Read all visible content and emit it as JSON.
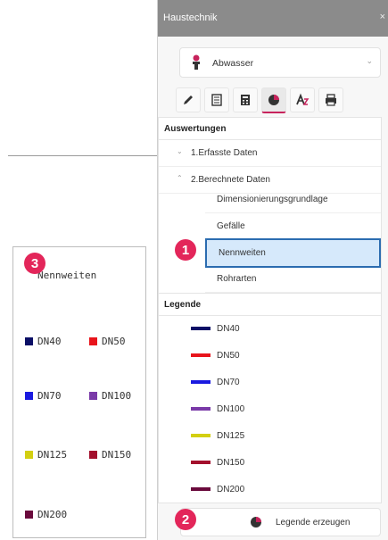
{
  "window": {
    "title": "Haustechnik",
    "close_glyph": "×"
  },
  "system_select": {
    "value": "Abwasser",
    "icon": "wastewater-icon"
  },
  "toolbar_tabs": [
    {
      "name": "pencil-icon"
    },
    {
      "name": "document-list-icon"
    },
    {
      "name": "calculator-icon"
    },
    {
      "name": "pie-chart-icon",
      "active": true
    },
    {
      "name": "text-format-icon"
    },
    {
      "name": "printer-icon"
    }
  ],
  "auswertungen": {
    "header": "Auswertungen",
    "items": [
      {
        "label": "1.Erfasste Daten",
        "expanded": false
      },
      {
        "label": "2.Berechnete Daten",
        "expanded": true
      }
    ],
    "sub_items": [
      {
        "label": "Dimensionierungsgrundlage"
      },
      {
        "label": "Gefälle"
      },
      {
        "label": "Nennweiten",
        "selected": true
      },
      {
        "label": "Rohrarten"
      }
    ]
  },
  "legende": {
    "header": "Legende",
    "entries": [
      {
        "label": "DN40",
        "color": "#0b0f66"
      },
      {
        "label": "DN50",
        "color": "#e8141b"
      },
      {
        "label": "DN70",
        "color": "#1a1ae0"
      },
      {
        "label": "DN100",
        "color": "#7a3aa8"
      },
      {
        "label": "DN125",
        "color": "#d3cf11"
      },
      {
        "label": "DN150",
        "color": "#a3102d"
      },
      {
        "label": "DN200",
        "color": "#6a0a3c"
      }
    ]
  },
  "legend_button": {
    "label": "Legende erzeugen"
  },
  "badges": {
    "one": "1",
    "two": "2",
    "three": "3"
  },
  "drawing_legend": {
    "title": "Nennweiten",
    "entries": [
      {
        "label": "DN40",
        "color": "#0b0f66"
      },
      {
        "label": "DN50",
        "color": "#e8141b"
      },
      {
        "label": "DN70",
        "color": "#1a1ae0"
      },
      {
        "label": "DN100",
        "color": "#7a3aa8"
      },
      {
        "label": "DN125",
        "color": "#d3cf11"
      },
      {
        "label": "DN150",
        "color": "#a3102d"
      },
      {
        "label": "DN200",
        "color": "#6a0a3c"
      }
    ]
  }
}
